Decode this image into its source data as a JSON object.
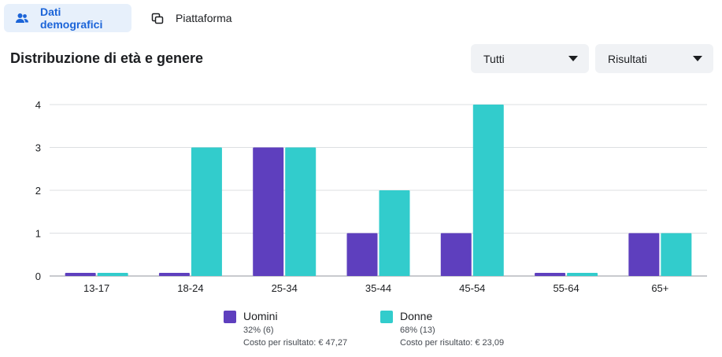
{
  "tabs": [
    {
      "label": "Dati demografici",
      "icon": "people-icon",
      "active": true
    },
    {
      "label": "Piattaforma",
      "icon": "devices-icon",
      "active": false
    }
  ],
  "section_title": "Distribuzione di età e genere",
  "filters": {
    "audience": {
      "selected": "Tutti"
    },
    "metric": {
      "selected": "Risultati"
    }
  },
  "colors": {
    "men": "#5e3fbe",
    "women": "#32cccc",
    "accent": "#1b64d8",
    "grid": "#dddfe2"
  },
  "chart_data": {
    "type": "bar",
    "categories": [
      "13-17",
      "18-24",
      "25-34",
      "35-44",
      "45-54",
      "55-64",
      "65+"
    ],
    "series": [
      {
        "name": "Uomini",
        "values": [
          0,
          0,
          3,
          1,
          1,
          0,
          1
        ],
        "color": "#5e3fbe"
      },
      {
        "name": "Donne",
        "values": [
          0,
          3,
          3,
          2,
          4,
          0,
          1
        ],
        "color": "#32cccc"
      }
    ],
    "yticks": [
      0,
      1,
      2,
      3,
      4
    ],
    "ylim": [
      0,
      4
    ],
    "grid": true,
    "legend_position": "bottom"
  },
  "legend": [
    {
      "name": "Uomini",
      "pct": "32% (6)",
      "cost": "Costo per risultato: € 47,27"
    },
    {
      "name": "Donne",
      "pct": "68% (13)",
      "cost": "Costo per risultato: € 23,09"
    }
  ]
}
